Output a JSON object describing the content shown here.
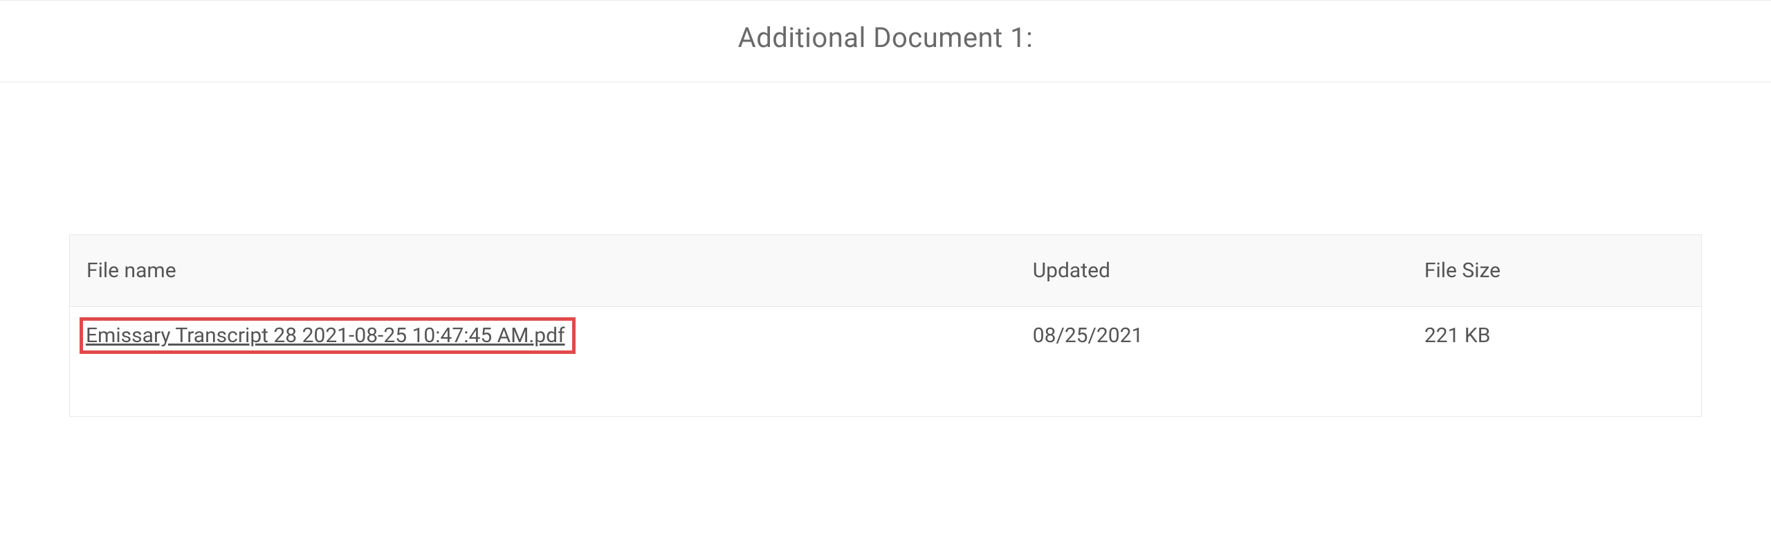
{
  "header": {
    "title": "Additional Document 1:"
  },
  "table": {
    "columns": {
      "name": "File name",
      "updated": "Updated",
      "size": "File Size"
    },
    "rows": [
      {
        "name": "Emissary Transcript 28 2021-08-25 10:47:45 AM.pdf",
        "updated": "08/25/2021",
        "size": "221 KB"
      }
    ]
  }
}
